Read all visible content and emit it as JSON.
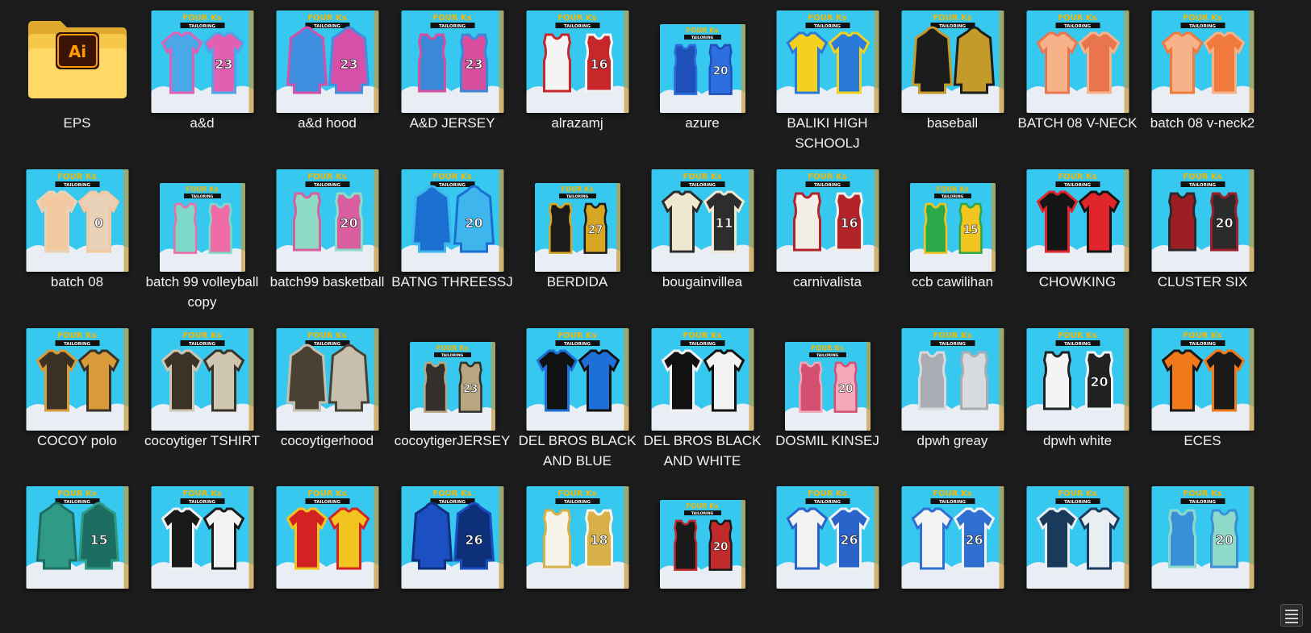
{
  "colors": {
    "background": "#1c1c1c",
    "label": "#f2f2f2",
    "sky": "#37c8f0",
    "cloud": "#e8eef4",
    "header_gold": "#f2b705",
    "ai_orange": "#ff9a00"
  },
  "folder": {
    "name": "EPS",
    "icon": "adobe-illustrator-folder-icon",
    "badge": "Ai"
  },
  "thumbnail_header": {
    "brand": "FOUR Ks",
    "sub": "TAILORING"
  },
  "files": [
    {
      "name": "a&d",
      "c1": "#4aa7e8",
      "c2": "#e35fb2",
      "kind": "shirt",
      "num": "23"
    },
    {
      "name": "a&d hood",
      "c1": "#3f8fe0",
      "c2": "#d64fa8",
      "kind": "hood",
      "num": "23"
    },
    {
      "name": "A&D JERSEY",
      "c1": "#3b88d9",
      "c2": "#d94e9e",
      "kind": "jersey",
      "num": "23"
    },
    {
      "name": "alrazamj",
      "c1": "#f4f4f4",
      "c2": "#c7262b",
      "kind": "jersey",
      "num": "16"
    },
    {
      "name": "azure",
      "c1": "#1f4fb8",
      "c2": "#2d6fe0",
      "kind": "jersey",
      "num": "20"
    },
    {
      "name": "BALIKI HIGH SCHOOLJ",
      "c1": "#f2d21f",
      "c2": "#2b7ad9",
      "kind": "polo",
      "num": ""
    },
    {
      "name": "baseball",
      "c1": "#1c1c1c",
      "c2": "#c49b2a",
      "kind": "hood",
      "num": ""
    },
    {
      "name": "BATCH 08 V-NECK",
      "c1": "#f6b38a",
      "c2": "#e8754d",
      "kind": "shirt",
      "num": ""
    },
    {
      "name": "batch 08 v-neck2",
      "c1": "#f6b38a",
      "c2": "#f07a3e",
      "kind": "shirt",
      "num": ""
    },
    {
      "name": "batch 08",
      "c1": "#f2c9a0",
      "c2": "#ead2b8",
      "kind": "shirt",
      "num": "0"
    },
    {
      "name": "batch 99 volleyball copy",
      "c1": "#7fd9c8",
      "c2": "#f06ca8",
      "kind": "jersey",
      "num": ""
    },
    {
      "name": "batch99 basketball",
      "c1": "#8fdcc6",
      "c2": "#d95ea0",
      "kind": "jersey",
      "num": "20"
    },
    {
      "name": "BATNG THREESSJ",
      "c1": "#1a6fd1",
      "c2": "#3fb5ee",
      "kind": "hood",
      "num": "20"
    },
    {
      "name": "BERDIDA",
      "c1": "#1b1b1b",
      "c2": "#d6a623",
      "kind": "jersey",
      "num": "27"
    },
    {
      "name": "bougainvillea",
      "c1": "#efe7cf",
      "c2": "#2d2d2d",
      "kind": "shirt",
      "num": "11"
    },
    {
      "name": "carnivalista",
      "c1": "#f4efe6",
      "c2": "#b2242a",
      "kind": "jersey",
      "num": "16"
    },
    {
      "name": "ccb cawilihan",
      "c1": "#2aa84a",
      "c2": "#f2c41f",
      "kind": "jersey",
      "num": "15"
    },
    {
      "name": "CHOWKING",
      "c1": "#151515",
      "c2": "#e0262b",
      "kind": "shirt",
      "num": ""
    },
    {
      "name": "CLUSTER SIX",
      "c1": "#9c1f25",
      "c2": "#2b2b2b",
      "kind": "jersey",
      "num": "20"
    },
    {
      "name": "COCOY polo",
      "c1": "#3a3025",
      "c2": "#d99a3a",
      "kind": "polo",
      "num": ""
    },
    {
      "name": "cocoytiger TSHIRT",
      "c1": "#3b3328",
      "c2": "#cfc6b2",
      "kind": "shirt",
      "num": ""
    },
    {
      "name": "cocoytigerhood",
      "c1": "#4a4134",
      "c2": "#c7bfae",
      "kind": "hood",
      "num": ""
    },
    {
      "name": "cocoytigerJERSEY",
      "c1": "#33302b",
      "c2": "#b9a57f",
      "kind": "jersey",
      "num": "23"
    },
    {
      "name": "DEL BROS BLACK AND BLUE",
      "c1": "#111111",
      "c2": "#1f6fd9",
      "kind": "shirt",
      "num": ""
    },
    {
      "name": "DEL BROS BLACK AND WHITE",
      "c1": "#111111",
      "c2": "#f2f2f2",
      "kind": "shirt",
      "num": ""
    },
    {
      "name": "DOSMIL KINSEJ",
      "c1": "#d45070",
      "c2": "#f2a8b8",
      "kind": "jersey",
      "num": "20"
    },
    {
      "name": "dpwh greay",
      "c1": "#a9adb3",
      "c2": "#d8dbde",
      "kind": "jersey",
      "num": ""
    },
    {
      "name": "dpwh white",
      "c1": "#f4f4f4",
      "c2": "#222222",
      "kind": "jersey",
      "num": "20"
    },
    {
      "name": "ECES",
      "c1": "#f07a1a",
      "c2": "#1a1a1a",
      "kind": "polo",
      "num": ""
    },
    {
      "name": "",
      "c1": "#2f9b86",
      "c2": "#1c6e63",
      "kind": "hood",
      "num": "15"
    },
    {
      "name": "",
      "c1": "#1a1a1a",
      "c2": "#f2f2f2",
      "kind": "polo",
      "num": ""
    },
    {
      "name": "",
      "c1": "#d32222",
      "c2": "#f2c41f",
      "kind": "polo",
      "num": ""
    },
    {
      "name": "",
      "c1": "#1b4fc2",
      "c2": "#0e2f7a",
      "kind": "hood",
      "num": "26"
    },
    {
      "name": "",
      "c1": "#f7f4ea",
      "c2": "#d8b04a",
      "kind": "jersey",
      "num": "18"
    },
    {
      "name": "",
      "c1": "#1a1a1a",
      "c2": "#c02a2a",
      "kind": "jersey",
      "num": "20"
    },
    {
      "name": "",
      "c1": "#f2f2f2",
      "c2": "#2a63c9",
      "kind": "shirt",
      "num": "26"
    },
    {
      "name": "",
      "c1": "#f2f2f2",
      "c2": "#2f6fd1",
      "kind": "shirt",
      "num": "26"
    },
    {
      "name": "",
      "c1": "#1a3a5c",
      "c2": "#e8eef2",
      "kind": "polo",
      "num": ""
    },
    {
      "name": "",
      "c1": "#3a8fd9",
      "c2": "#8fd9c8",
      "kind": "jersey",
      "num": "20"
    }
  ],
  "view_toggle": {
    "icon": "details-view-icon"
  }
}
